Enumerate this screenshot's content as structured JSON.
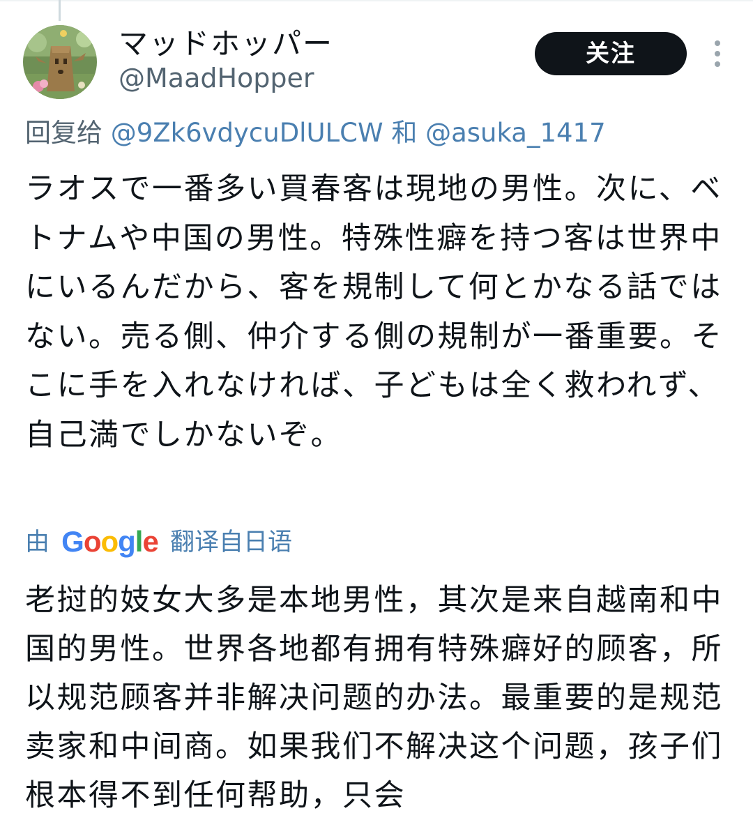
{
  "author": {
    "display_name": "マッドホッパー",
    "handle": "@MaadHopper",
    "avatar": "avatar-image"
  },
  "follow_button": {
    "label": "关注"
  },
  "more_button": {
    "icon": "vertical-dots-icon"
  },
  "reply_to": {
    "prefix": "回复给",
    "mention1": "@9Zk6vdycuDlULCW",
    "connector": "和",
    "mention2": "@asuka_1417"
  },
  "tweet": {
    "text": "ラオスで一番多い買春客は現地の男性。次に、ベトナムや中国の男性。特殊性癖を持つ客は世界中にいるんだから、客を規制して何とかなる話ではない。売る側、仲介する側の規制が一番重要。そこに手を入れなければ、子どもは全く救われず、自己満でしかないぞ。"
  },
  "translation": {
    "prefix": "由",
    "provider": "Google",
    "suffix": "翻译自日语",
    "text": "老挝的妓女大多是本地男性，其次是来自越南和中国的男性。世界各地都有拥有特殊癖好的顾客，所以规范顾客并非解决问题的办法。最重要的是规范卖家和中间商。如果我们不解决这个问题，孩子们根本得不到任何帮助，只会"
  },
  "colors": {
    "link": "#4a7fb0",
    "secondary_text": "#536471",
    "button_bg": "#0f1419"
  }
}
